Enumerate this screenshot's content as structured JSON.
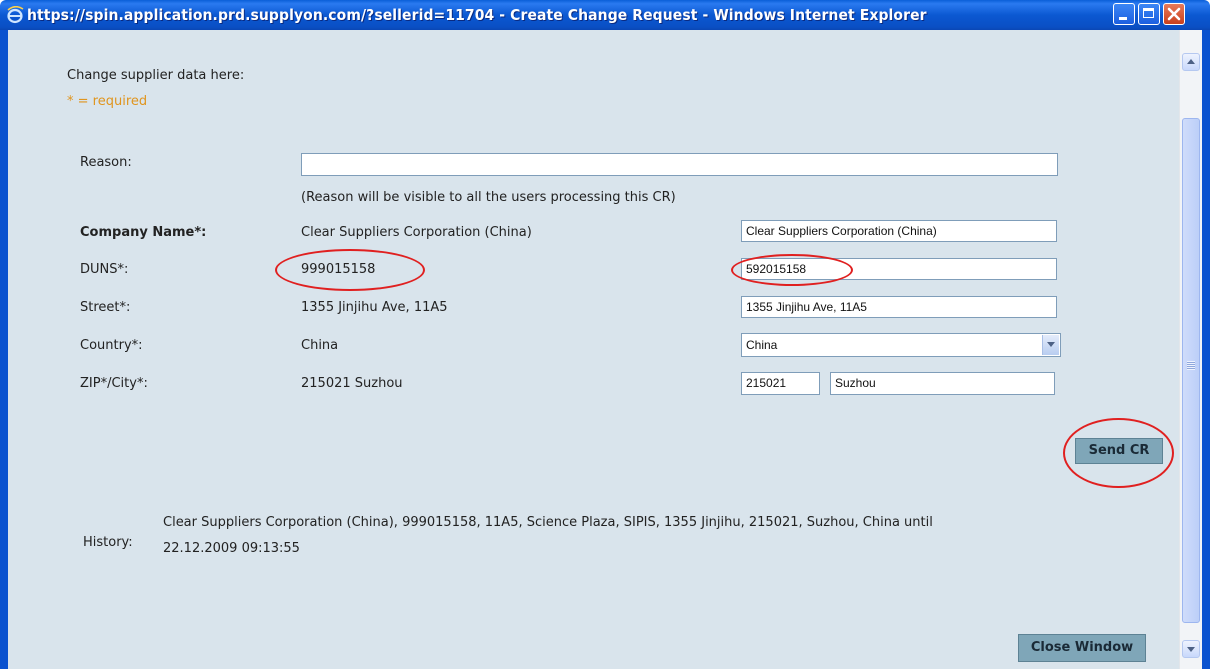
{
  "window": {
    "title": "https://spin.application.prd.supplyon.com/?sellerid=11704 - Create Change Request - Windows Internet Explorer"
  },
  "header": {
    "intro": "Change supplier data here:",
    "required_note": "* = required"
  },
  "reason": {
    "label": "Reason:",
    "value": "",
    "hint": "(Reason will be visible to all the users processing this CR)"
  },
  "fields": {
    "company": {
      "label": "Company Name*:",
      "current": "Clear Suppliers Corporation (China)",
      "new": "Clear Suppliers Corporation (China)"
    },
    "duns": {
      "label": "DUNS*:",
      "current": "999015158",
      "new": "592015158"
    },
    "street": {
      "label": "Street*:",
      "current": "1355 Jinjihu Ave, 11A5",
      "new": "1355 Jinjihu Ave, 11A5"
    },
    "country": {
      "label": "Country*:",
      "current": "China",
      "new": "China"
    },
    "zip_city": {
      "label": "ZIP*/City*:",
      "current": "215021 Suzhou",
      "new_zip": "215021",
      "new_city": "Suzhou"
    }
  },
  "buttons": {
    "send": "Send CR",
    "close": "Close Window"
  },
  "history": {
    "label": "History:",
    "line1": "Clear Suppliers Corporation (China), 999015158, 11A5, Science Plaza, SIPIS, 1355 Jinjihu, 215021, Suzhou, China until",
    "line2": "22.12.2009 09:13:55"
  },
  "colors": {
    "titlebar": "#0a5fd8",
    "content_bg": "#d9e4ec",
    "required": "#e0951e",
    "button": "#7fa6b8",
    "annotation": "#e02020"
  }
}
